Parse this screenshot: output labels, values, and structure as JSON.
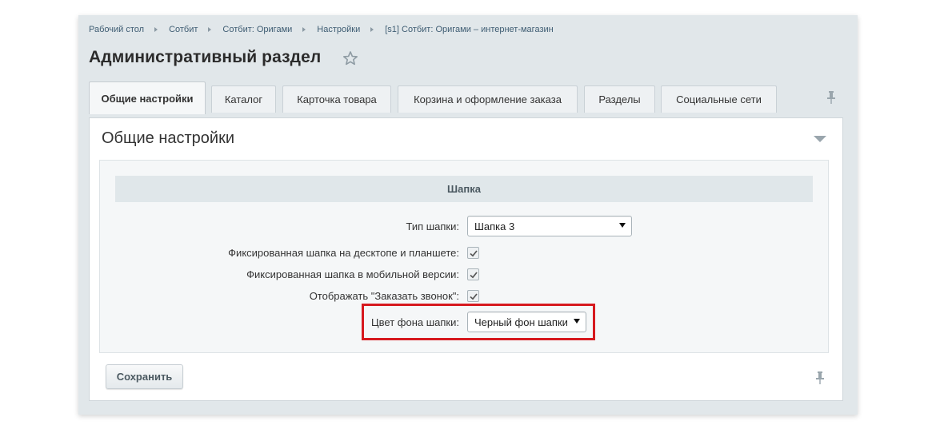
{
  "breadcrumb": [
    "Рабочий стол",
    "Сотбит",
    "Сотбит: Оригами",
    "Настройки",
    "[s1] Сотбит: Оригами – интернет-магазин"
  ],
  "page_title": "Административный раздел",
  "tabs": [
    {
      "label": "Общие настройки",
      "active": true
    },
    {
      "label": "Каталог"
    },
    {
      "label": "Карточка товара"
    },
    {
      "label": "Корзина и оформление заказа"
    },
    {
      "label": "Разделы"
    },
    {
      "label": "Социальные сети"
    }
  ],
  "section": {
    "title": "Общие настройки"
  },
  "settings": {
    "header": "Шапка",
    "header_type": {
      "label": "Тип шапки:",
      "value": "Шапка 3"
    },
    "fixed_desktop": {
      "label": "Фиксированная шапка на десктопе и планшете:",
      "checked": true
    },
    "fixed_mobile": {
      "label": "Фиксированная шапка в мобильной версии:",
      "checked": true
    },
    "show_callback": {
      "label": "Отображать \"Заказать звонок\":",
      "checked": true
    },
    "header_bg": {
      "label": "Цвет фона шапки:",
      "value": "Черный фон шапки"
    }
  },
  "save_label": "Сохранить",
  "colors": {
    "highlight": "#d6191e",
    "panel": "#e1e7ea",
    "link": "#3f5d73"
  }
}
